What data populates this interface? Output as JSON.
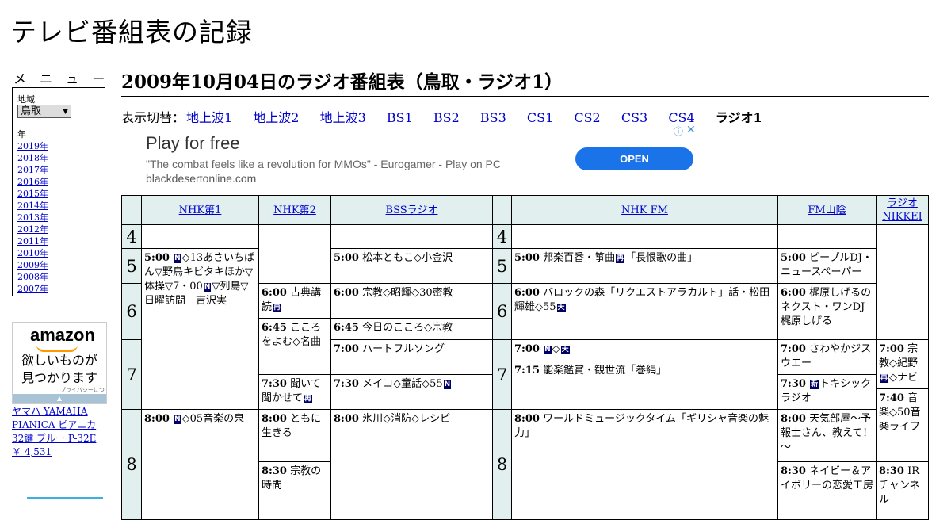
{
  "site": {
    "title": "テレビ番組表の記録"
  },
  "menu": {
    "heading": "メ ニ ュ ー",
    "region_label": "地域",
    "region_value": "鳥取",
    "year_label": "年",
    "years": [
      "2019年",
      "2018年",
      "2017年",
      "2016年",
      "2015年",
      "2014年",
      "2013年",
      "2012年",
      "2011年",
      "2010年",
      "2009年",
      "2008年",
      "2007年"
    ]
  },
  "amazon_ad": {
    "logo": "amazon",
    "line1": "欲しいものが",
    "line2": "見つかります",
    "privacy": "プライバシーについて",
    "product_link": "ヤマハ YAMAHA PIANICA ピアニカ 32鍵 ブルー P-32E",
    "price": "￥ 4,531"
  },
  "page": {
    "heading": "2009年10月04日のラジオ番組表（鳥取・ラジオ1）"
  },
  "switcher": {
    "label": "表示切替：",
    "links": [
      "地上波1",
      "地上波2",
      "地上波3",
      "BS1",
      "BS2",
      "BS3",
      "CS1",
      "CS2",
      "CS3",
      "CS4"
    ],
    "current": "ラジオ1"
  },
  "ad_banner": {
    "headline": "Play for free",
    "quote": "\"The combat feels like a revolution for MMOs\" - Eurogamer - Play on PC",
    "domain": "blackdesertonline.com",
    "cta": "OPEN",
    "info_icon": "ⓘ",
    "close_icon": "✕"
  },
  "schedule": {
    "channels": [
      "NHK第1",
      "NHK第2",
      "BSSラジオ",
      "NHK FM",
      "FM山陰",
      "ラジオNIKKEI"
    ],
    "hours": [
      "4",
      "5",
      "6",
      "7",
      "8"
    ],
    "programs": {
      "nhk1_0500_time": "5:00",
      "nhk1_0500_text": "◇13あさいちばん▽野鳥キビタキほか▽体操▽7・00",
      "nhk1_0500_text2": "▽列島▽日曜訪問　吉沢実",
      "nhk1_0800_time": "8:00",
      "nhk1_0800_text": "◇05音楽の泉",
      "nhk2_0600_time": "6:00",
      "nhk2_0600_text": "古典講読",
      "nhk2_0645_time": "6:45",
      "nhk2_0645_text": "こころをよむ◇名曲",
      "nhk2_0730_time": "7:30",
      "nhk2_0730_text": "聞いて聞かせて",
      "nhk2_0800_time": "8:00",
      "nhk2_0800_text": "ともに生きる",
      "nhk2_0830_time": "8:30",
      "nhk2_0830_text": "宗教の時間",
      "bss_0500_time": "5:00",
      "bss_0500_text": "松本ともこ◇小金沢",
      "bss_0600_time": "6:00",
      "bss_0600_text": "宗教◇昭輝◇30密教",
      "bss_0645_time": "6:45",
      "bss_0645_text": "今日のこころ◇宗教",
      "bss_0700_time": "7:00",
      "bss_0700_text": "ハートフルソング",
      "bss_0730_time": "7:30",
      "bss_0730_text": "メイコ◇童話◇55",
      "bss_0800_time": "8:00",
      "bss_0800_text": "氷川◇消防◇レシピ",
      "fm_0500_time": "5:00",
      "fm_0500_text": "邦楽百番・箏曲",
      "fm_0500_text2": "「長恨歌の曲」",
      "fm_0600_time": "6:00",
      "fm_0600_text": "バロックの森「リクエストアラカルト」話・松田輝雄◇55",
      "fm_0700_time": "7:00",
      "fm_0700_text": "◇",
      "fm_0715_time": "7:15",
      "fm_0715_text": "能楽鑑賞・観世流「巻絹」",
      "fm_0800_time": "8:00",
      "fm_0800_text": "ワールドミュージックタイム「ギリシャ音楽の魅力」",
      "sanin_0500_time": "5:00",
      "sanin_0500_text": "ピープルDJ・ニュースペーパー",
      "sanin_0600_time": "6:00",
      "sanin_0600_text": "梶原しげるのネクスト・ワンDJ梶原しげる",
      "sanin_0700_time": "7:00",
      "sanin_0700_text": "さわやかジスウエー",
      "sanin_0730_time": "7:30",
      "sanin_0730_text": "トキシックラジオ",
      "sanin_0800_time": "8:00",
      "sanin_0800_text": "天気部屋～予報士さん、教えて！～",
      "sanin_0830_time": "8:30",
      "sanin_0830_text": "ネイビー＆アイボリーの恋愛工房",
      "nikkei_0700_time": "7:00",
      "nikkei_0700_text": "宗教◇紀野",
      "nikkei_0700_text2": "◇ナビ",
      "nikkei_0740_time": "7:40",
      "nikkei_0740_text": "音楽◇50音楽ライフ",
      "nikkei_0830_time": "8:30",
      "nikkei_0830_text": "IRチャンネル"
    },
    "marks": {
      "news": "N",
      "rerun": "再",
      "weather": "天",
      "new": "新"
    }
  }
}
